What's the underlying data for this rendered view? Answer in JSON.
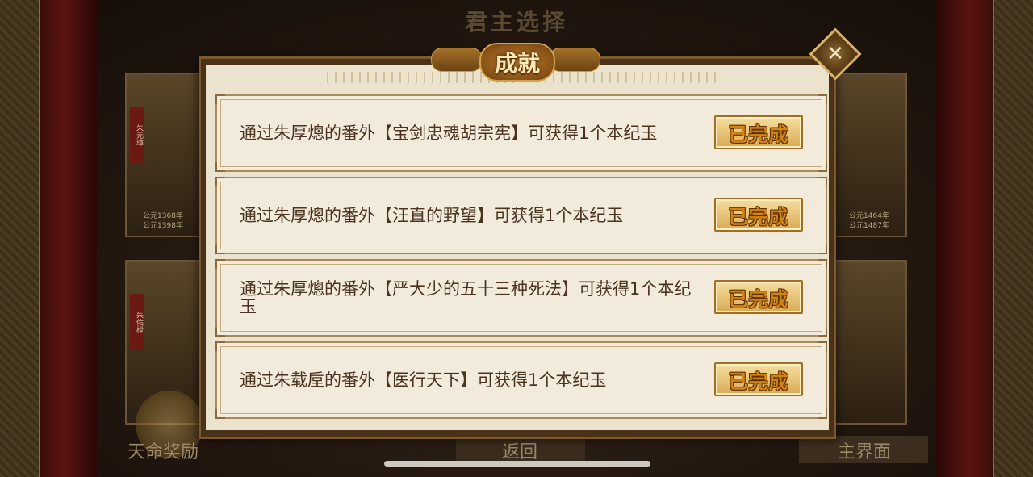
{
  "background": {
    "title": "君主选择",
    "portraits": [
      {
        "tag": "朱元璋",
        "years": [
          "公元1368年",
          "公元1398年"
        ]
      },
      {
        "tag": "",
        "years": [
          "公元1464年",
          "公元1487年"
        ]
      },
      {
        "tag": "朱佑樘",
        "years": []
      },
      {
        "tag": "",
        "years": []
      }
    ],
    "fate_reward_label": "天命奖励",
    "back_label": "返回",
    "main_menu_label": "主界面"
  },
  "dialog": {
    "title": "成就",
    "close_icon": "close-icon",
    "achievements": [
      {
        "text": "通过朱厚熜的番外【宝剑忠魂胡宗宪】可获得1个本纪玉",
        "status": "已完成"
      },
      {
        "text": "通过朱厚熜的番外【汪直的野望】可获得1个本纪玉",
        "status": "已完成"
      },
      {
        "text": "通过朱厚熜的番外【严大少的五十三种死法】可获得1个本纪玉",
        "status": "已完成"
      },
      {
        "text": "通过朱载垕的番外【医行天下】可获得1个本纪玉",
        "status": "已完成"
      }
    ]
  },
  "colors": {
    "dialog_bg": "#ece3cf",
    "row_text": "#4a3420",
    "done_text": "#d28412",
    "plaque": "#8a5418"
  }
}
